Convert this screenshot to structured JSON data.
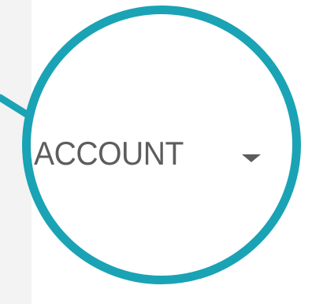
{
  "account_menu": {
    "label": "ACCOUNT",
    "caret_icon": "chevron-down-icon"
  },
  "colors": {
    "ring": "#1aa3b5",
    "text": "#5d5d5d",
    "background_left": "#f3f3f3"
  }
}
